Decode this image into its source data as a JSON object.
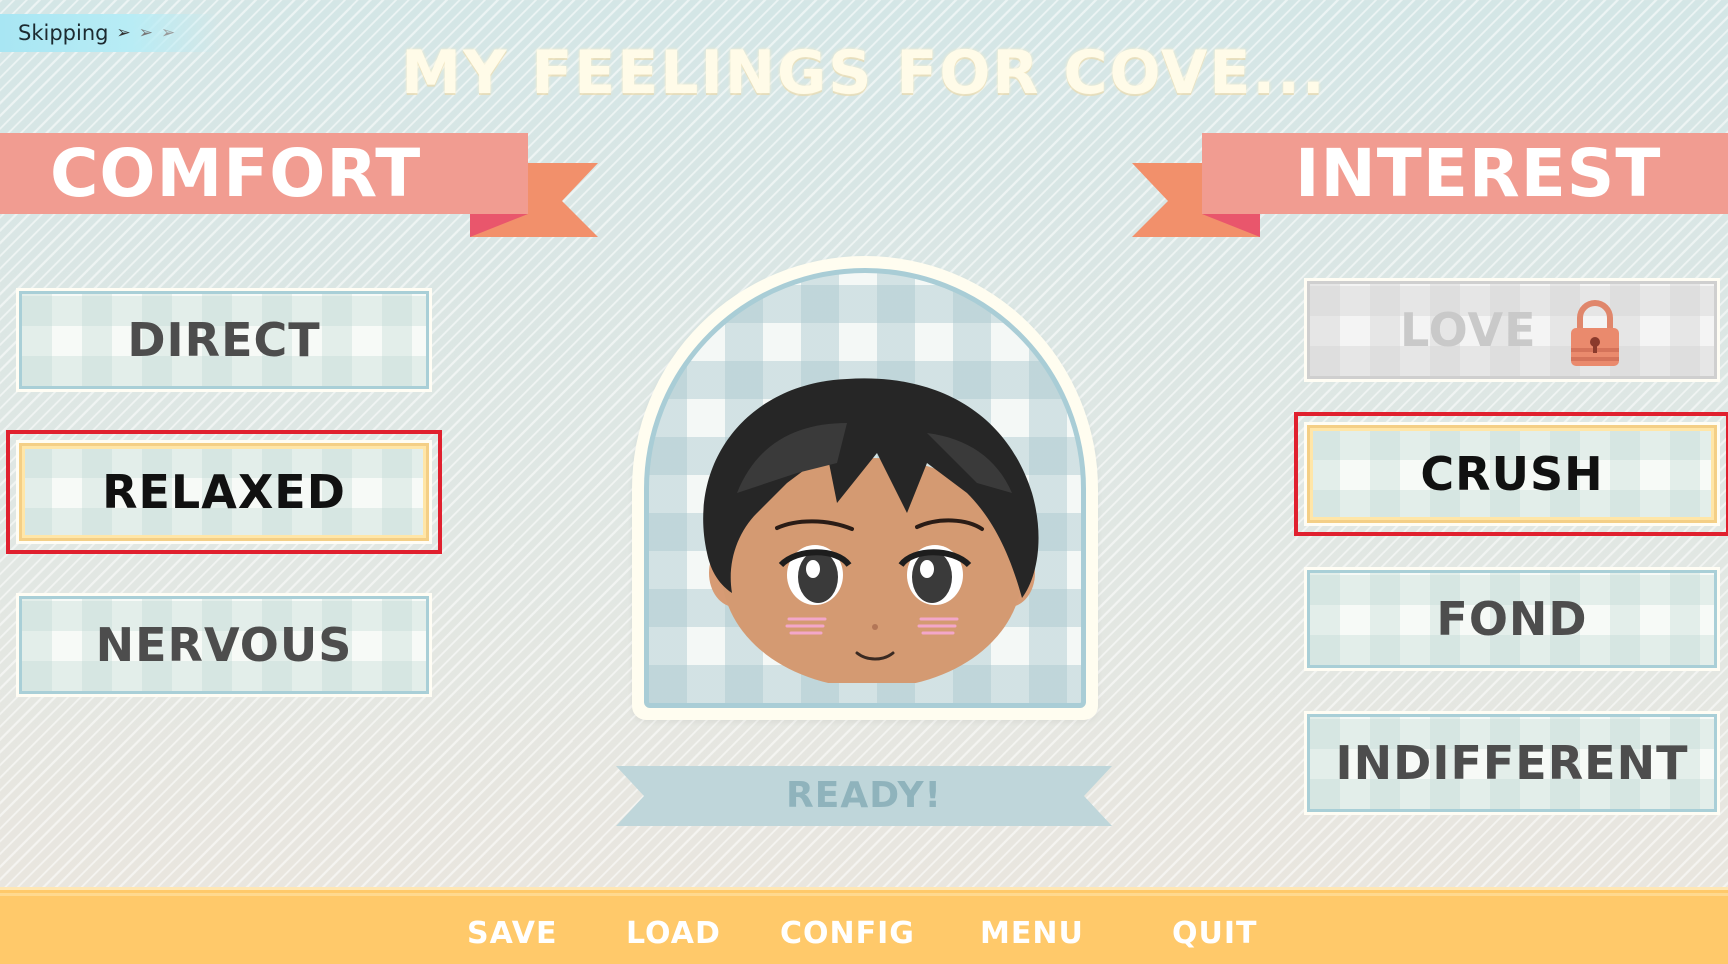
{
  "skip": {
    "label": "Skipping",
    "arrows": [
      "➢",
      "➢",
      "➢"
    ]
  },
  "title": "MY FEELINGS FOR COVE...",
  "comfort": {
    "heading": "COMFORT",
    "options": [
      {
        "label": "DIRECT",
        "selected": false
      },
      {
        "label": "RELAXED",
        "selected": true
      },
      {
        "label": "NERVOUS",
        "selected": false
      }
    ]
  },
  "interest": {
    "heading": "INTEREST",
    "options": [
      {
        "label": "LOVE",
        "selected": false,
        "locked": true
      },
      {
        "label": "CRUSH",
        "selected": true
      },
      {
        "label": "FOND",
        "selected": false
      },
      {
        "label": "INDIFFERENT",
        "selected": false
      }
    ]
  },
  "ready_label": "READY!",
  "menu": {
    "save": "SAVE",
    "load": "LOAD",
    "config": "CONFIG",
    "menu": "MENU",
    "quit": "QUIT"
  },
  "colors": {
    "ribbon": "#f19c91",
    "ribbon_tail": "#f2906b",
    "selection": "#e0202e",
    "bottom_bar": "#ffc96a"
  }
}
